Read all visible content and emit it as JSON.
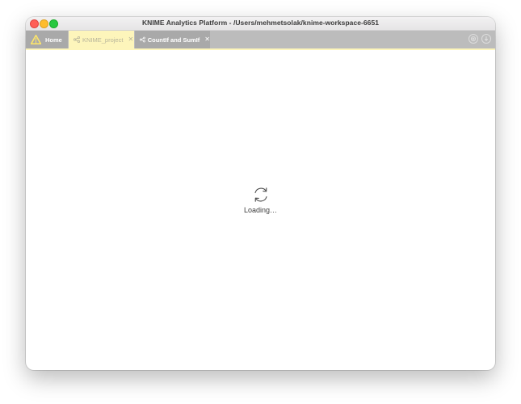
{
  "window": {
    "title": "KNIME Analytics Platform - /Users/mehmetsolak/knime-workspace-6651"
  },
  "tabs": [
    {
      "label": "Home",
      "icon": "knime-triangle-icon",
      "active": false,
      "closable": false
    },
    {
      "label": "KNIME_project",
      "icon": "workflow-icon",
      "active": true,
      "closable": true
    },
    {
      "label": "CountIf and SumIf",
      "icon": "workflow-icon",
      "active": false,
      "closable": true
    }
  ],
  "toolbar_right": [
    {
      "icon": "help-icon"
    },
    {
      "icon": "download-icon"
    }
  ],
  "main": {
    "loading_text": "Loading…",
    "icon": "refresh-spinner-icon"
  },
  "colors": {
    "active_tab": "#fdf5bb",
    "tab_bar": "#bcbcbc",
    "inactive_tab": "#a9a9a9",
    "knime_yellow": "#fce46a"
  }
}
